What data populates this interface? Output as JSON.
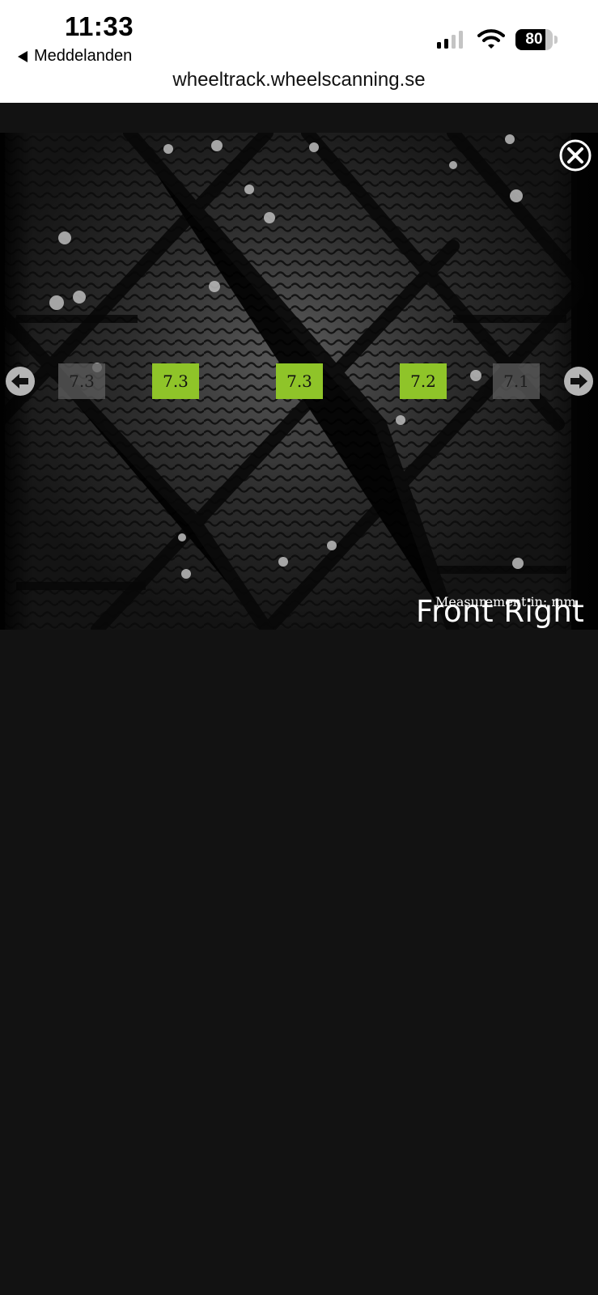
{
  "status_bar": {
    "time": "11:33",
    "back_label": "Meddelanden",
    "battery_level": "80",
    "battery_fraction": 0.8,
    "signal_bars_active": 2,
    "signal_bars_total": 4
  },
  "address_bar": {
    "url": "wheeltrack.wheelscanning.se"
  },
  "viewer": {
    "measurement_unit_note": "Measurement in: mm",
    "wheel_position": "Front Right",
    "depth_readings": [
      {
        "value": "7.3",
        "state": "dim"
      },
      {
        "value": "7.3",
        "state": "active"
      },
      {
        "value": "7.3",
        "state": "active"
      },
      {
        "value": "7.2",
        "state": "active"
      },
      {
        "value": "7.1",
        "state": "dim"
      }
    ],
    "icons": {
      "close": "close-circle-icon",
      "previous": "arrow-left-circle-icon",
      "next": "arrow-right-circle-icon"
    },
    "colors": {
      "active_reading": "#8fc429",
      "background": "#121212"
    }
  }
}
